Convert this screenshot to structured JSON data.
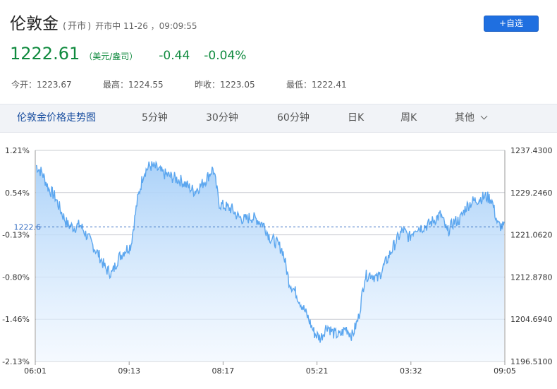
{
  "header": {
    "title": "伦敦金",
    "status_open": "(",
    "status": "开市",
    "status_close": ")",
    "market_time": "开市中 11-26 ，09:09:55",
    "watch_button": "+自选"
  },
  "quote": {
    "price": "1222.61",
    "unit": "（美元/盎司）",
    "change": "-0.44",
    "change_pct": "-0.04%"
  },
  "stats": [
    {
      "label": "今开：",
      "value": "1223.67"
    },
    {
      "label": "最高：",
      "value": "1224.55"
    },
    {
      "label": "昨收：",
      "value": "1223.05"
    },
    {
      "label": "最低：",
      "value": "1222.41"
    }
  ],
  "tabs": [
    "伦敦金价格走势图",
    "5分钟",
    "30分钟",
    "60分钟",
    "日K",
    "周K",
    "其他"
  ],
  "colors": {
    "down": "#0f8a3e",
    "line": "#5ba6ef",
    "fill_top": "#a6cff8",
    "fill_bottom": "#eef6ff",
    "button": "#1f6fe0"
  },
  "chart_data": {
    "type": "area",
    "reference_value": 1222.6,
    "reference_label": "1222.6",
    "ylim": [
      1196.51,
      1237.43
    ],
    "y_ticks_price": [
      "1237.4300",
      "1229.2460",
      "1221.0620",
      "1212.8780",
      "1204.6940",
      "1196.5100"
    ],
    "y_ticks_pct": [
      "1.21%",
      "0.54%",
      "-0.13%",
      "-0.80%",
      "-1.46%",
      "-2.13%"
    ],
    "x_ticks": [
      "06:01",
      "09:13",
      "08:17",
      "05:21",
      "03:32",
      "09:05"
    ],
    "series": [
      {
        "values": [
          1234.5,
          1233.0,
          1230.0,
          1228.5,
          1225.5,
          1223.0,
          1222.5,
          1223.0,
          1221.0,
          1219.0,
          1217.0,
          1214.5,
          1213.5,
          1216.5,
          1218.0,
          1219.0,
          1227.5,
          1233.0,
          1234.5,
          1234.0,
          1233.0,
          1232.5,
          1232.0,
          1231.5,
          1230.5,
          1229.5,
          1230.5,
          1232.0,
          1234.0,
          1227.0,
          1226.5,
          1226.0,
          1224.5,
          1224.0,
          1224.5,
          1224.0,
          1223.0,
          1220.5,
          1219.5,
          1218.0,
          1212.0,
          1210.0,
          1207.5,
          1205.0,
          1202.0,
          1201.0,
          1203.5,
          1202.0,
          1201.5,
          1203.0,
          1201.5,
          1205.0,
          1213.0,
          1213.5,
          1212.5,
          1215.0,
          1217.5,
          1220.0,
          1222.0,
          1220.5,
          1222.5,
          1222.5,
          1223.0,
          1224.0,
          1225.0,
          1221.5,
          1223.5,
          1224.0,
          1226.5,
          1227.5,
          1228.0,
          1228.5,
          1228.0,
          1223.0,
          1222.5
        ]
      }
    ]
  }
}
